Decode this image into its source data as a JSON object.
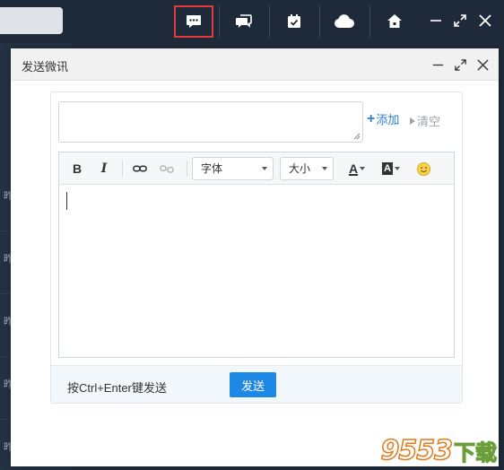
{
  "dialog": {
    "title": "发送微讯",
    "add_label": "添加",
    "clear_label": "清空",
    "font_select": "字体",
    "size_select": "大小",
    "bold_label": "B",
    "italic_label": "I",
    "font_color_label": "A",
    "bg_color_label": "A",
    "hint": "按Ctrl+Enter键发送",
    "send_label": "发送"
  },
  "sidebar": {
    "rows": [
      "昨",
      "昨",
      "昨",
      "昨",
      "昨"
    ]
  },
  "watermark": {
    "number": "9553",
    "text": "下载"
  },
  "colors": {
    "topbar": "#1e2a39",
    "accent": "#1e88e5",
    "link": "#2d7ecf",
    "highlight": "#e23a3a"
  },
  "icons": [
    "message-icon",
    "chat-icon",
    "calendar-check-icon",
    "cloud-icon",
    "home-icon",
    "minimize-icon",
    "maximize-icon",
    "close-icon",
    "link-icon",
    "unlink-icon",
    "emoji-icon"
  ]
}
